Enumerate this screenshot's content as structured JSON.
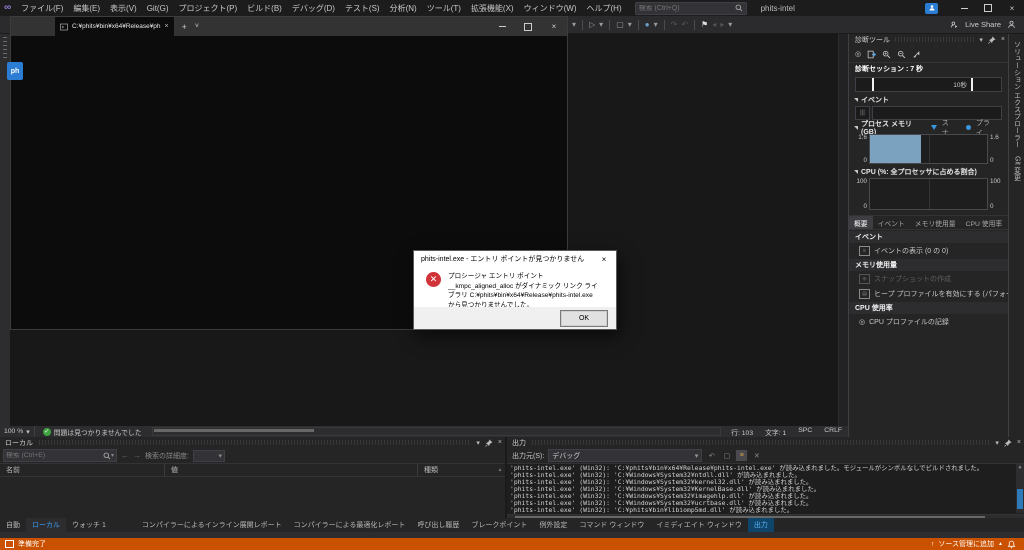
{
  "glyphs": {
    "close": "×",
    "chevron": "▾",
    "chevron_small": "˅",
    "plus": "+",
    "play": "▷",
    "square": "▢",
    "circle": "●",
    "record": "◎",
    "infinity": "∞",
    "flag": "⚑",
    "back": "←",
    "forward": "→",
    "tri_up": "▲",
    "tri_down": "▼",
    "arr_left": "◂",
    "arr_right": "▸",
    "up": "↑",
    "check": "✓",
    "x_mark": "✕",
    "bars": "≡",
    "step1": "↷",
    "step2": "↶"
  },
  "colors": {
    "status_orange": "#ca5100",
    "accent_blue": "#007acc",
    "selected_tab_blue": "#3ea0f7",
    "memory_fill": "#7ba3bf",
    "error_red": "#d13438",
    "terminal_bg": "#0c0c0c"
  },
  "titlebar": {
    "menus": [
      "ファイル(F)",
      "編集(E)",
      "表示(V)",
      "Git(G)",
      "プロジェクト(P)",
      "ビルド(B)",
      "デバッグ(D)",
      "テスト(S)",
      "分析(N)",
      "ツール(T)",
      "拡張機能(X)",
      "ウィンドウ(W)",
      "ヘルプ(H)"
    ],
    "search_placeholder": "検索 (Ctrl+Q)",
    "window_title": "phits-intel"
  },
  "toolbar": {
    "live_share": "Live Share"
  },
  "terminal": {
    "tab_title": "C:¥phits¥bin¥x64¥Release¥ph",
    "badge": "ph"
  },
  "dialog": {
    "title": "phits-intel.exe - エントリ ポイントが見つかりません",
    "message": "プロシージャ エントリ ポイント __kmpc_aligned_alloc がダイナミック リンク ライブラリ C:¥phits¥bin¥x64¥Release¥phits-intel.exe から見つかりませんでした。",
    "ok_label": "OK"
  },
  "diagnostics": {
    "title": "診断ツール",
    "session_label": "診断セッション : 7 秒",
    "timeline_label": "10秒",
    "events_header": "イベント",
    "memory_header": "プロセス メモリ (GB)",
    "legend_snapshot": "スナ...",
    "legend_private": "プライ...",
    "memory_max": "1.6",
    "memory_min": "0",
    "cpu_header": "CPU (%: 全プロセッサに占める割合)",
    "cpu_max": "100",
    "cpu_min": "0",
    "tabs": [
      "概要",
      "イベント",
      "メモリ使用量",
      "CPU 使用率"
    ],
    "summary": {
      "events_section": "イベント",
      "events_link": "イベントの表示 (0 の 0)",
      "memory_section": "メモリ使用量",
      "snapshot_link": "スナップショットの作成",
      "heap_link": "ヒープ プロファイルを有効にする (パフォーマンスに影響します)",
      "cpu_section": "CPU 使用率",
      "cpu_link": "CPU プロファイルの記録"
    }
  },
  "right_tabs": {
    "solution_explorer": "ソリューション エクスプローラー",
    "git_changes": "Git 変更"
  },
  "editor_status": {
    "zoom": "100 %",
    "no_issues": "問題は見つかりませんでした",
    "line": "行: 103",
    "char": "文字: 1",
    "spc": "SPC",
    "eol": "CRLF"
  },
  "locals": {
    "title": "ローカル",
    "search_placeholder": "検索 (Ctrl+E)",
    "detail_label": "検索の詳細度:",
    "columns": [
      "名前",
      "値",
      "種類"
    ],
    "tabs": [
      "自動",
      "ローカル",
      "ウォッチ 1"
    ]
  },
  "output": {
    "title": "出力",
    "source_label": "出力元(S):",
    "source_value": "デバッグ",
    "lines": [
      "'phits-intel.exe' (Win32): 'C:¥phits¥bin¥x64¥Release¥phits-intel.exe' が読み込まれました。モジュールがシンボルなしでビルドされました。",
      "'phits-intel.exe' (Win32): 'C:¥Windows¥System32¥ntdll.dll' が読み込まれました。",
      "'phits-intel.exe' (Win32): 'C:¥Windows¥System32¥kernel32.dll' が読み込まれました。",
      "'phits-intel.exe' (Win32): 'C:¥Windows¥System32¥KernelBase.dll' が読み込まれました。",
      "'phits-intel.exe' (Win32): 'C:¥Windows¥System32¥imagehlp.dll' が読み込まれました。",
      "'phits-intel.exe' (Win32): 'C:¥Windows¥System32¥ucrtbase.dll' が読み込まれました。",
      "'phits-intel.exe' (Win32): 'C:¥phits¥bin¥libiomp5md.dll' が読み込まれました。"
    ],
    "tabs": [
      "コンパイラーによるインライン展開レポート",
      "コンパイラーによる最適化レポート",
      "呼び出し履歴",
      "ブレークポイント",
      "例外設定",
      "コマンド ウィンドウ",
      "イミディエイト ウィンドウ",
      "出力"
    ]
  },
  "statusbar": {
    "ready": "準備完了",
    "source_control": "ソース管理に追加"
  }
}
